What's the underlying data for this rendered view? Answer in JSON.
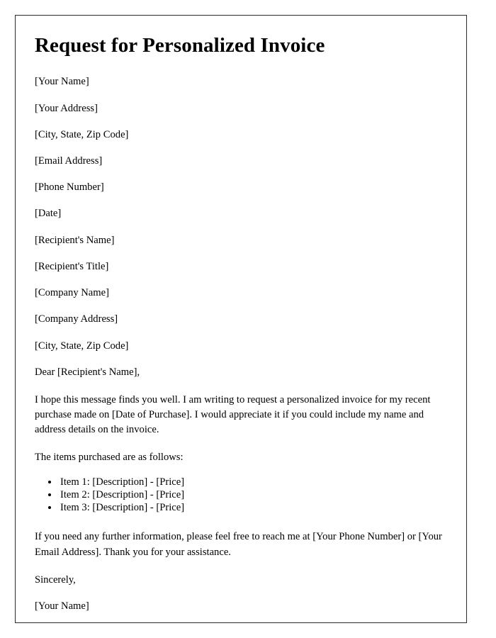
{
  "document": {
    "title": "Request for Personalized Invoice",
    "sender_block": [
      "[Your Name]",
      "[Your Address]",
      "[City, State, Zip Code]",
      "[Email Address]",
      "[Phone Number]",
      "[Date]"
    ],
    "recipient_block": [
      "[Recipient's Name]",
      "[Recipient's Title]",
      "[Company Name]",
      "[Company Address]",
      "[City, State, Zip Code]"
    ],
    "salutation": "Dear [Recipient's Name],",
    "body_paragraph": "I hope this message finds you well. I am writing to request a personalized invoice for my recent purchase made on [Date of Purchase]. I would appreciate it if you could include my name and address details on the invoice.",
    "list_lead_in": "The items purchased are as follows:",
    "items": [
      "Item 1: [Description] - [Price]",
      "Item 2: [Description] - [Price]",
      "Item 3: [Description] - [Price]"
    ],
    "contact_paragraph": "If you need any further information, please feel free to reach me at [Your Phone Number] or [Your Email Address]. Thank you for your assistance.",
    "closing": "Sincerely,",
    "signature": "[Your Name]",
    "colors": {
      "text": "#000000",
      "border": "#2b2b2b",
      "background": "#ffffff"
    }
  }
}
